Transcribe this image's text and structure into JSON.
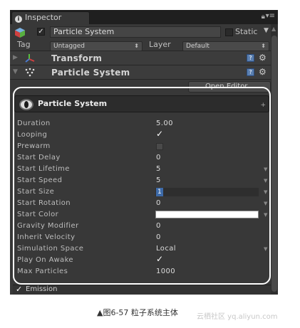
{
  "window": {
    "tab_label": "Inspector"
  },
  "gameobject": {
    "active": "✓",
    "name": "Particle System",
    "static_label": "Static",
    "tag_label": "Tag",
    "tag_value": "Untagged",
    "layer_label": "Layer",
    "layer_value": "Default"
  },
  "components": [
    {
      "title": "Transform"
    },
    {
      "title": "Particle System"
    }
  ],
  "open_editor_label": "Open Editor...",
  "module": {
    "title": "Particle System",
    "properties": [
      {
        "label": "Duration",
        "value": "5.00"
      },
      {
        "label": "Looping",
        "value": "✓"
      },
      {
        "label": "Prewarm",
        "value": ""
      },
      {
        "label": "Start Delay",
        "value": "0"
      },
      {
        "label": "Start Lifetime",
        "value": "5"
      },
      {
        "label": "Start Speed",
        "value": "5"
      },
      {
        "label": "Start Size",
        "value": "1"
      },
      {
        "label": "Start Rotation",
        "value": "0"
      },
      {
        "label": "Start Color",
        "value": ""
      },
      {
        "label": "Gravity Modifier",
        "value": "0"
      },
      {
        "label": "Inherit Velocity",
        "value": "0"
      },
      {
        "label": "Simulation Space",
        "value": "Local"
      },
      {
        "label": "Play On Awake",
        "value": "✓"
      },
      {
        "label": "Max Particles",
        "value": "1000"
      }
    ],
    "start_color": "#ffffff"
  },
  "emission": {
    "checked": "✓",
    "label": "Emission"
  },
  "caption": "▲图6-57 粒子系统主体",
  "watermark": "云栖社区 yq.aliyun.com",
  "colors": {
    "panel_bg": "#383838",
    "selection": "#3d6aa8",
    "frame_highlight": "#ffffff"
  }
}
